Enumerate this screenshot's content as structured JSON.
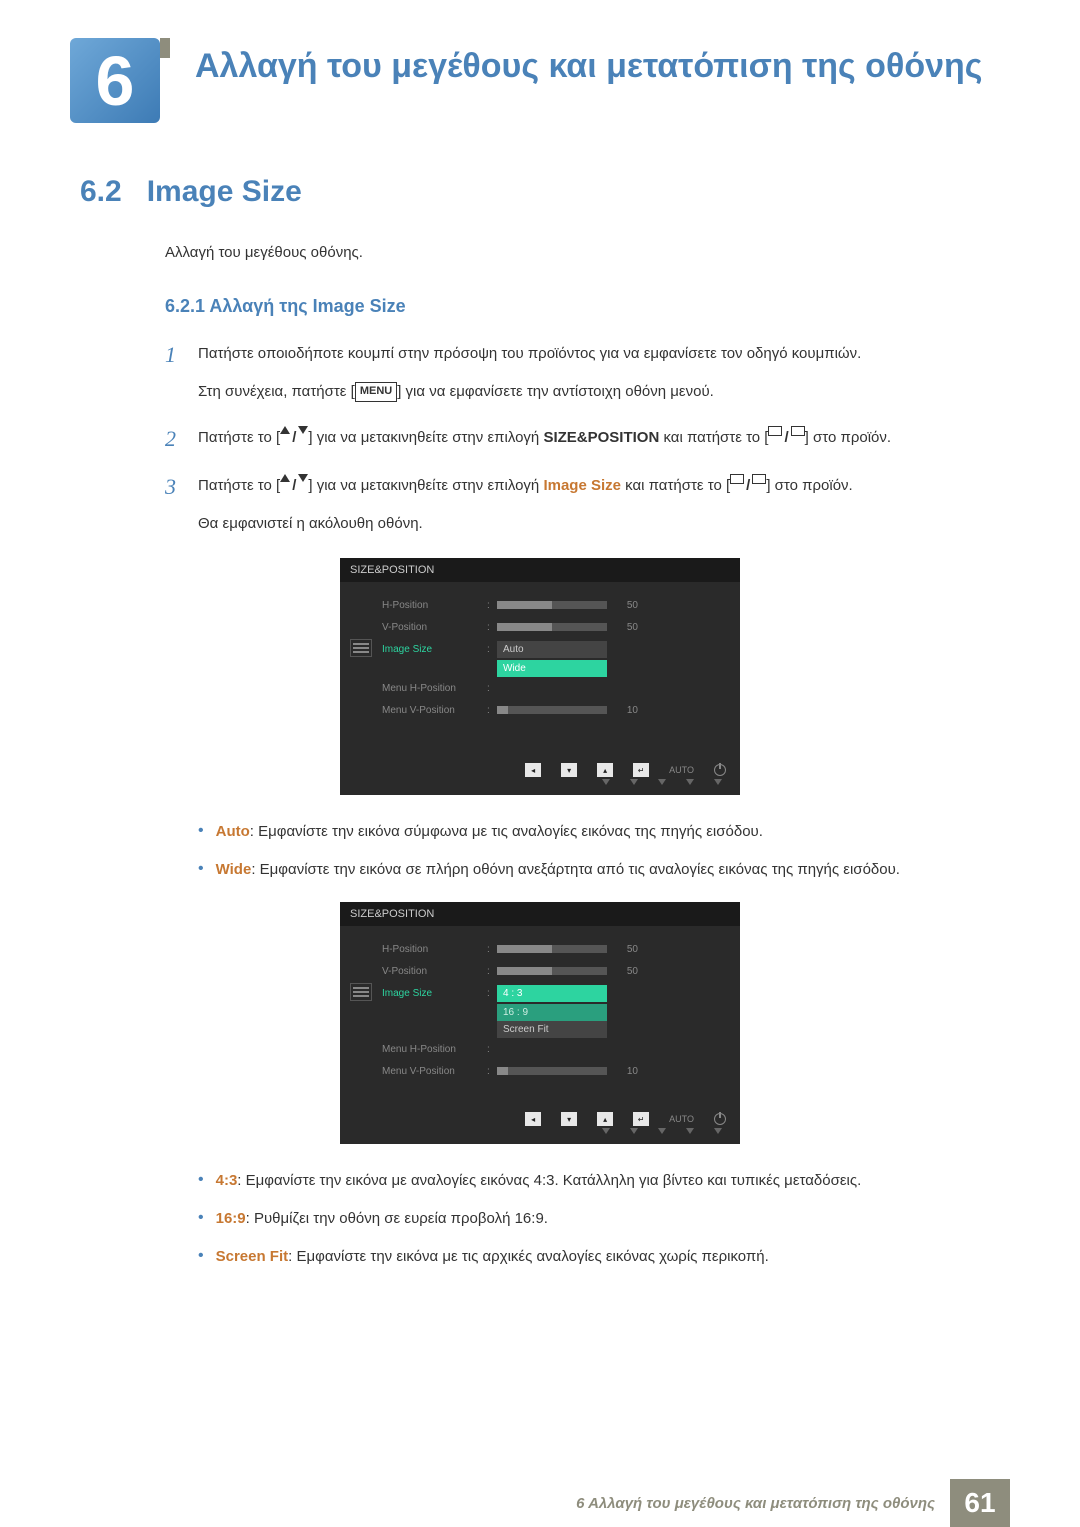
{
  "chapter": {
    "number": "6",
    "title": "Αλλαγή του μεγέθους και μετατόπιση της οθόνης"
  },
  "section": {
    "number": "6.2",
    "title": "Image Size",
    "intro": "Αλλαγή του μεγέθους οθόνης."
  },
  "subsection": {
    "title": "6.2.1  Αλλαγή της Image Size"
  },
  "steps": {
    "s1": "Πατήστε οποιοδήποτε κουμπί στην πρόσοψη του προϊόντος για να εμφανίσετε τον οδηγό κουμπιών.",
    "s1b_before": "Στη συνέχεια, πατήστε [",
    "s1b_menu": "MENU",
    "s1b_after": "] για να εμφανίσετε την αντίστοιχη οθόνη μενού.",
    "s2a": "Πατήστε το [",
    "s2b": "] για να μετακινηθείτε στην επιλογή ",
    "s2_kw": "SIZE&POSITION",
    "s2c": " και πατήστε το [",
    "s2d": "] στο προϊόν.",
    "s3a": "Πατήστε το [",
    "s3b": "] για να μετακινηθείτε στην επιλογή ",
    "s3_kw": "Image Size",
    "s3c": " και πατήστε το [",
    "s3d": "] στο προϊόν.",
    "s3e": "Θα εμφανιστεί η ακόλουθη οθόνη."
  },
  "osd1": {
    "title": "SIZE&POSITION",
    "rows": {
      "hpos": "H-Position",
      "vpos": "V-Position",
      "imgsize": "Image Size",
      "mhpos": "Menu H-Position",
      "mvpos": "Menu V-Position"
    },
    "vals": {
      "hpos": "50",
      "vpos": "50",
      "mvpos": "10"
    },
    "opts": {
      "auto": "Auto",
      "wide": "Wide"
    },
    "auto_label": "AUTO"
  },
  "osd2": {
    "title": "SIZE&POSITION",
    "rows": {
      "hpos": "H-Position",
      "vpos": "V-Position",
      "imgsize": "Image Size",
      "mhpos": "Menu H-Position",
      "mvpos": "Menu V-Position"
    },
    "vals": {
      "hpos": "50",
      "vpos": "50",
      "mvpos": "10"
    },
    "opts": {
      "o43": "4 : 3",
      "o169": "16 : 9",
      "sf": "Screen Fit"
    },
    "auto_label": "AUTO"
  },
  "bullets1": {
    "auto_kw": "Auto",
    "auto_txt": ": Εμφανίστε την εικόνα σύμφωνα με τις αναλογίες εικόνας της πηγής εισόδου.",
    "wide_kw": "Wide",
    "wide_txt": ": Εμφανίστε την εικόνα σε πλήρη οθόνη ανεξάρτητα από τις αναλογίες εικόνας της πηγής εισόδου."
  },
  "bullets2": {
    "b43_kw": "4:3",
    "b43_txt": ": Εμφανίστε την εικόνα με αναλογίες εικόνας 4:3. Κατάλληλη για βίντεο και τυπικές μεταδόσεις.",
    "b169_kw": "16:9",
    "b169_txt": ": Ρυθμίζει την οθόνη σε ευρεία προβολή 16:9.",
    "sf_kw": "Screen Fit",
    "sf_txt": ": Εμφανίστε την εικόνα με τις αρχικές αναλογίες εικόνας χωρίς περικοπή."
  },
  "footer": {
    "text": "6 Αλλαγή του μεγέθους και μετατόπιση της οθόνης",
    "page": "61"
  }
}
